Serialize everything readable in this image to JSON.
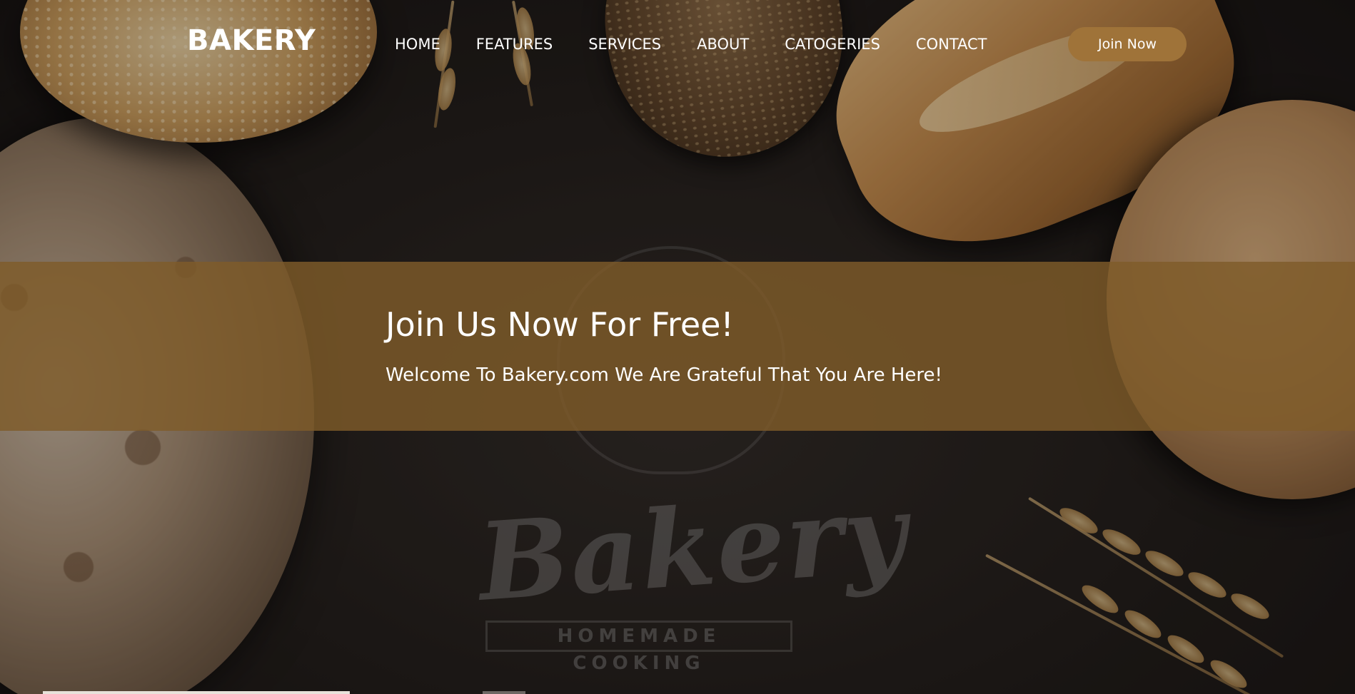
{
  "brand": {
    "name": "BAKERY"
  },
  "nav": {
    "items": [
      {
        "label": "HOME"
      },
      {
        "label": "FEATURES"
      },
      {
        "label": "SERVICES"
      },
      {
        "label": "ABOUT"
      },
      {
        "label": "CATOGERIES"
      },
      {
        "label": "CONTACT"
      }
    ],
    "cta_label": "Join Now"
  },
  "banner": {
    "title": "Join Us Now For Free!",
    "subtitle": "Welcome To Bakery.com We Are Grateful That You Are Here!"
  },
  "background": {
    "logo_text": "Bakery",
    "logo_sub": "HOMEMADE COOKING"
  },
  "colors": {
    "accent": "#9f7339",
    "banner": "#7f5b2a",
    "text": "#ffffff"
  }
}
